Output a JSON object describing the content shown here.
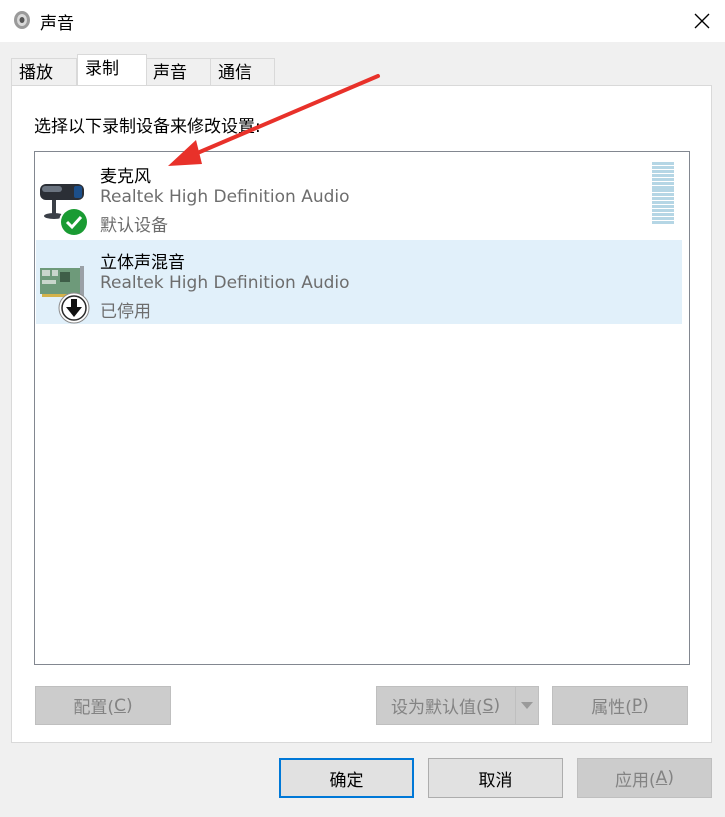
{
  "window": {
    "title": "声音"
  },
  "tabs": [
    {
      "label": "播放"
    },
    {
      "label": "录制"
    },
    {
      "label": "声音"
    },
    {
      "label": "通信"
    }
  ],
  "active_tab": "录制",
  "instruction": "选择以下录制设备来修改设置:",
  "devices": [
    {
      "name": "麦克风",
      "description": "Realtek High Definition Audio",
      "status": "默认设备",
      "status_icon": "check-icon",
      "device_icon": "microphone-icon"
    },
    {
      "name": "立体声混音",
      "description": "Realtek High Definition Audio",
      "status": "已停用",
      "status_icon": "down-arrow-icon",
      "device_icon": "sound-card-icon",
      "selected": true
    }
  ],
  "buttons": {
    "configure": {
      "label": "配置(",
      "key": "C",
      "suffix": ")"
    },
    "set_default": {
      "label": "设为默认值(",
      "key": "S",
      "suffix": ")"
    },
    "properties": {
      "label": "属性(",
      "key": "P",
      "suffix": ")"
    },
    "ok": {
      "label": "确定"
    },
    "cancel": {
      "label": "取消"
    },
    "apply": {
      "label": "应用(",
      "key": "A",
      "suffix": ")"
    }
  },
  "colors": {
    "selection": "#e1f0fa",
    "default_button_border": "#0078d7",
    "annotation_arrow": "#e8312a",
    "check_green": "#1a9b33"
  }
}
